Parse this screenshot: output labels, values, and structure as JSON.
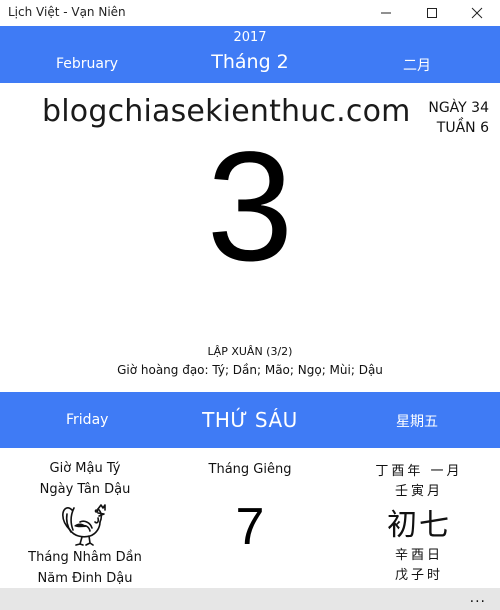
{
  "window": {
    "title": "Lịch Việt - Vạn Niên",
    "minimize_icon": "minimize-icon",
    "maximize_icon": "maximize-icon",
    "close_icon": "close-icon"
  },
  "colors": {
    "accent": "#3f7bf5",
    "appbar": "#e6e6e6"
  },
  "header": {
    "year": "2017",
    "month_en": "February",
    "month_vn": "Tháng 2",
    "month_cn": "二月"
  },
  "main": {
    "watermark": "blogchiasekienthuc.com",
    "day_of_year": "NGÀY 34",
    "week_of_year": "TUẦN 6",
    "day": "3",
    "solar_term": "LẬP XUÂN (3/2)",
    "lucky_hours": "Giờ hoàng đạo: Tý; Dần; Mão; Ngọ; Mùi; Dậu"
  },
  "weekday": {
    "en": "Friday",
    "vn": "THỨ SÁU",
    "cn": "星期五"
  },
  "lunar": {
    "hour": "Giờ Mậu Tý",
    "day_name": "Ngày Tân Dậu",
    "zodiac_icon": "rooster-icon",
    "month_name": "Tháng Nhâm Dần",
    "year_name": "Năm Đinh Dậu",
    "month_label": "Tháng Giêng",
    "day": "7",
    "cn_year_month": "丁酉年 一月",
    "cn_month_ganzhi": "壬寅月",
    "cn_day": "初七",
    "cn_day_ganzhi": "辛酉日",
    "cn_hour_ganzhi": "戊子时"
  },
  "appbar": {
    "more_label": "...",
    "more_icon": "more-icon"
  }
}
